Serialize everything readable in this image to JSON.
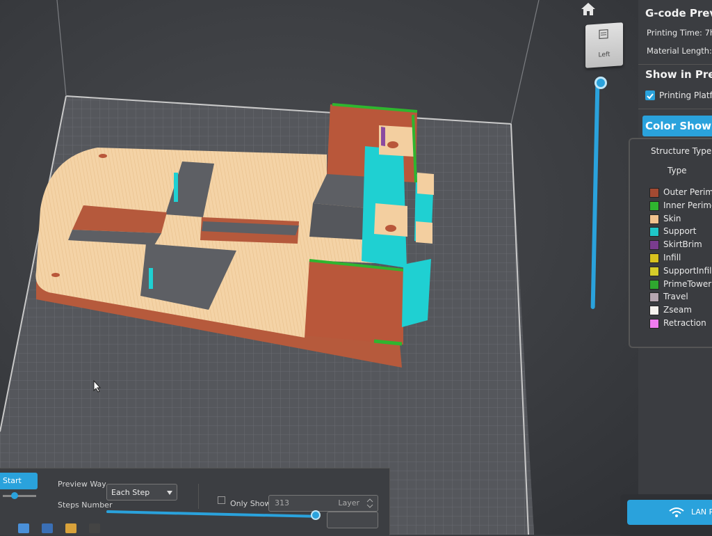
{
  "side_panel": {
    "title": "G-code Prev",
    "printing_time_label": "Printing Time: 7h",
    "material_length_label": "Material Length:",
    "show_in_preview_title": "Show in Pre",
    "printing_platform_label": "Printing Platfo",
    "printing_platform_checked": true,
    "color_show_label": "Color Show",
    "structure_type_label": "Structure Type",
    "type_header": "Type",
    "legend": [
      {
        "label": "Outer Perim",
        "color": "#a34a32"
      },
      {
        "label": "Inner Perime",
        "color": "#2fb52f"
      },
      {
        "label": "Skin",
        "color": "#f0c28e"
      },
      {
        "label": "Support",
        "color": "#1fc6c8"
      },
      {
        "label": "SkirtBrim",
        "color": "#7a3c8e"
      },
      {
        "label": "Infill",
        "color": "#d8c21e"
      },
      {
        "label": "SupportInfill",
        "color": "#d6cc2a"
      },
      {
        "label": "PrimeTower",
        "color": "#2fa82f"
      },
      {
        "label": "Travel",
        "color": "#b6a6b0"
      },
      {
        "label": "Zseam",
        "color": "#f6f2ee"
      },
      {
        "label": "Retraction",
        "color": "#f07cf0"
      }
    ],
    "lan_label": "LAN P"
  },
  "view_cube": {
    "face_label": "Left"
  },
  "bottom_bar": {
    "start_label": "Start",
    "preview_way_label": "Preview Way",
    "preview_way_value": "Each Step",
    "steps_number_label": "Steps Number",
    "only_show_label": "Only Show",
    "only_show_checked": false,
    "layer_value": "313",
    "layer_unit": "Layer"
  },
  "colors": {
    "accent": "#2aa2dc",
    "outer_perimeter": "#b9573a",
    "skin": "#f3cfa0",
    "support": "#1fd0d2",
    "inner_perimeter": "#2fb52f"
  }
}
